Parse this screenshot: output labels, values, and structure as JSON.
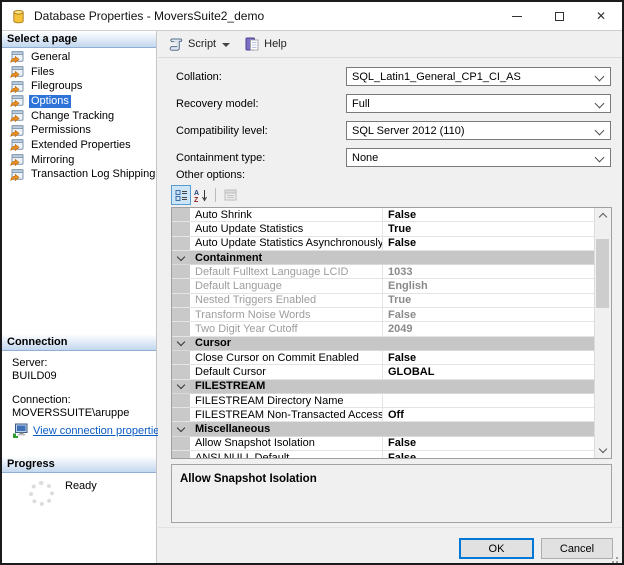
{
  "window": {
    "title": "Database Properties - MoversSuite2_demo"
  },
  "sidebar": {
    "header": "Select a page",
    "items": [
      {
        "label": "General",
        "selected": false
      },
      {
        "label": "Files",
        "selected": false
      },
      {
        "label": "Filegroups",
        "selected": false
      },
      {
        "label": "Options",
        "selected": true
      },
      {
        "label": "Change Tracking",
        "selected": false
      },
      {
        "label": "Permissions",
        "selected": false
      },
      {
        "label": "Extended Properties",
        "selected": false
      },
      {
        "label": "Mirroring",
        "selected": false
      },
      {
        "label": "Transaction Log Shipping",
        "selected": false
      }
    ]
  },
  "connection": {
    "header": "Connection",
    "server_label": "Server:",
    "server_value": "BUILD09",
    "connection_label": "Connection:",
    "connection_value": "MOVERSSUITE\\aruppe",
    "link_label": "View connection properties"
  },
  "progress": {
    "header": "Progress",
    "status": "Ready"
  },
  "toolbar": {
    "script_label": "Script",
    "help_label": "Help"
  },
  "form": {
    "fields": [
      {
        "label": "Collation:",
        "value": "SQL_Latin1_General_CP1_CI_AS",
        "highlighted": false
      },
      {
        "label": "Recovery model:",
        "value": "Full",
        "highlighted": false
      },
      {
        "label": "Compatibility level:",
        "value": "SQL Server 2012 (110)",
        "highlighted": true
      },
      {
        "label": "Containment type:",
        "value": "None",
        "highlighted": false
      }
    ],
    "other_options_label": "Other options:"
  },
  "grid": {
    "rows": [
      {
        "type": "property",
        "label": "Auto Shrink",
        "value": "False",
        "disabled": false
      },
      {
        "type": "property",
        "label": "Auto Update Statistics",
        "value": "True",
        "disabled": false
      },
      {
        "type": "property",
        "label": "Auto Update Statistics Asynchronously",
        "value": "False",
        "disabled": false
      },
      {
        "type": "category",
        "label": "Containment"
      },
      {
        "type": "property",
        "label": "Default Fulltext Language LCID",
        "value": "1033",
        "disabled": true
      },
      {
        "type": "property",
        "label": "Default Language",
        "value": "English",
        "disabled": true
      },
      {
        "type": "property",
        "label": "Nested Triggers Enabled",
        "value": "True",
        "disabled": true
      },
      {
        "type": "property",
        "label": "Transform Noise Words",
        "value": "False",
        "disabled": true
      },
      {
        "type": "property",
        "label": "Two Digit Year Cutoff",
        "value": "2049",
        "disabled": true
      },
      {
        "type": "category",
        "label": "Cursor"
      },
      {
        "type": "property",
        "label": "Close Cursor on Commit Enabled",
        "value": "False",
        "disabled": false
      },
      {
        "type": "property",
        "label": "Default Cursor",
        "value": "GLOBAL",
        "disabled": false
      },
      {
        "type": "category",
        "label": "FILESTREAM"
      },
      {
        "type": "property",
        "label": "FILESTREAM Directory Name",
        "value": "",
        "disabled": false
      },
      {
        "type": "property",
        "label": "FILESTREAM Non-Transacted Access",
        "value": "Off",
        "disabled": false
      },
      {
        "type": "category",
        "label": "Miscellaneous"
      },
      {
        "type": "property",
        "label": "Allow Snapshot Isolation",
        "value": "False",
        "disabled": false
      },
      {
        "type": "property",
        "label": "ANSI NULL Default",
        "value": "False",
        "disabled": false
      }
    ]
  },
  "description": {
    "title": "Allow Snapshot Isolation"
  },
  "buttons": {
    "ok": "OK",
    "cancel": "Cancel"
  },
  "icons": {
    "titlebar": "database-cylinder",
    "script": "script-scroll",
    "help": "help-book",
    "tree_item": "page-with-orange-arrow",
    "connection_link": "monitor-network",
    "progress": "spinner-ring",
    "options_toolbar": [
      "categorized-view",
      "alphabetical-sort",
      "property-pages"
    ]
  },
  "colors": {
    "accent_orange": "#E8943A",
    "selection_blue": "#2E74D8",
    "link_blue": "#0A5BC4",
    "category_gray": "#C6C6C6",
    "default_button_blue": "#0078D7"
  }
}
